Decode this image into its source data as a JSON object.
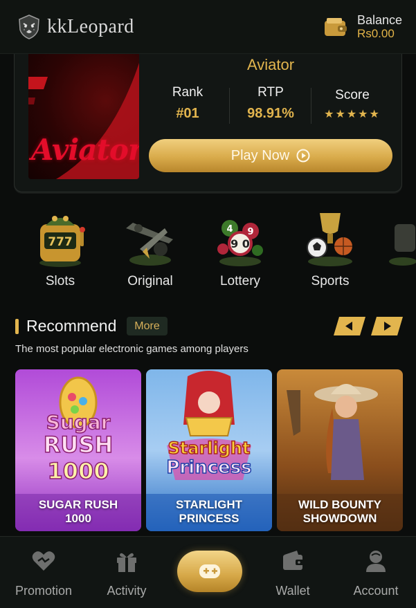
{
  "header": {
    "brand": "kkLeopard",
    "balance_label": "Balance",
    "balance_value": "Rs0.00"
  },
  "featured": {
    "thumb_text": "Aviator",
    "title": "Aviator",
    "stats": [
      {
        "label": "Rank",
        "value": "#01"
      },
      {
        "label": "RTP",
        "value": "98.91%"
      },
      {
        "label": "Score",
        "value": "★★★★★"
      }
    ],
    "play_label": "Play Now"
  },
  "categories": [
    {
      "label": "Slots",
      "icon": "slot-machine-icon"
    },
    {
      "label": "Original",
      "icon": "airplane-icon"
    },
    {
      "label": "Lottery",
      "icon": "lottery-balls-icon"
    },
    {
      "label": "Sports",
      "icon": "sports-trophy-icon"
    }
  ],
  "recommend": {
    "title": "Recommend",
    "more_label": "More",
    "subtitle": "The most popular electronic games among players"
  },
  "games": [
    {
      "name_line1": "SUGAR RUSH",
      "name_line2": "1000"
    },
    {
      "name_line1": "STARLIGHT",
      "name_line2": "PRINCESS"
    },
    {
      "name_line1": "WILD BOUNTY",
      "name_line2": "SHOWDOWN"
    }
  ],
  "bottom_nav": [
    {
      "label": "Promotion",
      "icon": "heart-promotion-icon"
    },
    {
      "label": "Activity",
      "icon": "gift-icon"
    },
    {
      "label": "",
      "icon": "gamepad-icon"
    },
    {
      "label": "Wallet",
      "icon": "wallet-icon"
    },
    {
      "label": "Account",
      "icon": "user-icon"
    }
  ],
  "colors": {
    "accent_gold": "#e2b54e",
    "background": "#0b0d0c",
    "card": "#121614",
    "text_muted": "#a9aaa9"
  }
}
